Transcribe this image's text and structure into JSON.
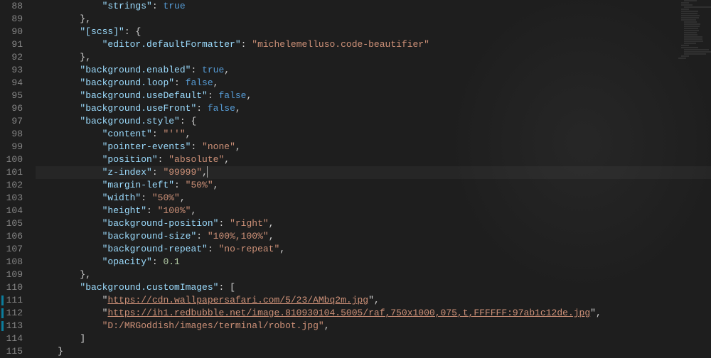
{
  "editor": {
    "startLine": 88,
    "highlightLine": 101,
    "modifiedLines": [
      111,
      112,
      113
    ],
    "lines": [
      {
        "n": 88,
        "indent": 3,
        "tokens": [
          {
            "t": "key",
            "v": "\"strings\""
          },
          {
            "t": "p",
            "v": ": "
          },
          {
            "t": "bool",
            "v": "true"
          }
        ]
      },
      {
        "n": 89,
        "indent": 2,
        "tokens": [
          {
            "t": "p",
            "v": "},"
          }
        ]
      },
      {
        "n": 90,
        "indent": 2,
        "tokens": [
          {
            "t": "key",
            "v": "\"[scss]\""
          },
          {
            "t": "p",
            "v": ": {"
          }
        ]
      },
      {
        "n": 91,
        "indent": 3,
        "tokens": [
          {
            "t": "key",
            "v": "\"editor.defaultFormatter\""
          },
          {
            "t": "p",
            "v": ": "
          },
          {
            "t": "str",
            "v": "\"michelemelluso.code-beautifier\""
          }
        ]
      },
      {
        "n": 92,
        "indent": 2,
        "tokens": [
          {
            "t": "p",
            "v": "},"
          }
        ]
      },
      {
        "n": 93,
        "indent": 2,
        "tokens": [
          {
            "t": "key",
            "v": "\"background.enabled\""
          },
          {
            "t": "p",
            "v": ": "
          },
          {
            "t": "bool",
            "v": "true"
          },
          {
            "t": "p",
            "v": ","
          }
        ]
      },
      {
        "n": 94,
        "indent": 2,
        "tokens": [
          {
            "t": "key",
            "v": "\"background.loop\""
          },
          {
            "t": "p",
            "v": ": "
          },
          {
            "t": "bool",
            "v": "false"
          },
          {
            "t": "p",
            "v": ","
          }
        ]
      },
      {
        "n": 95,
        "indent": 2,
        "tokens": [
          {
            "t": "key",
            "v": "\"background.useDefault\""
          },
          {
            "t": "p",
            "v": ": "
          },
          {
            "t": "bool",
            "v": "false"
          },
          {
            "t": "p",
            "v": ","
          }
        ]
      },
      {
        "n": 96,
        "indent": 2,
        "tokens": [
          {
            "t": "key",
            "v": "\"background.useFront\""
          },
          {
            "t": "p",
            "v": ": "
          },
          {
            "t": "bool",
            "v": "false"
          },
          {
            "t": "p",
            "v": ","
          }
        ]
      },
      {
        "n": 97,
        "indent": 2,
        "tokens": [
          {
            "t": "key",
            "v": "\"background.style\""
          },
          {
            "t": "p",
            "v": ": {"
          }
        ]
      },
      {
        "n": 98,
        "indent": 3,
        "tokens": [
          {
            "t": "key",
            "v": "\"content\""
          },
          {
            "t": "p",
            "v": ": "
          },
          {
            "t": "str",
            "v": "\"''\""
          },
          {
            "t": "p",
            "v": ","
          }
        ]
      },
      {
        "n": 99,
        "indent": 3,
        "tokens": [
          {
            "t": "key",
            "v": "\"pointer-events\""
          },
          {
            "t": "p",
            "v": ": "
          },
          {
            "t": "str",
            "v": "\"none\""
          },
          {
            "t": "p",
            "v": ","
          }
        ]
      },
      {
        "n": 100,
        "indent": 3,
        "tokens": [
          {
            "t": "key",
            "v": "\"position\""
          },
          {
            "t": "p",
            "v": ": "
          },
          {
            "t": "str",
            "v": "\"absolute\""
          },
          {
            "t": "p",
            "v": ","
          }
        ]
      },
      {
        "n": 101,
        "indent": 3,
        "tokens": [
          {
            "t": "key",
            "v": "\"z-index\""
          },
          {
            "t": "p",
            "v": ": "
          },
          {
            "t": "str",
            "v": "\"99999\""
          },
          {
            "t": "p",
            "v": ","
          },
          {
            "t": "cursor",
            "v": ""
          }
        ]
      },
      {
        "n": 102,
        "indent": 3,
        "tokens": [
          {
            "t": "key",
            "v": "\"margin-left\""
          },
          {
            "t": "p",
            "v": ": "
          },
          {
            "t": "str",
            "v": "\"50%\""
          },
          {
            "t": "p",
            "v": ","
          }
        ]
      },
      {
        "n": 103,
        "indent": 3,
        "tokens": [
          {
            "t": "key",
            "v": "\"width\""
          },
          {
            "t": "p",
            "v": ": "
          },
          {
            "t": "str",
            "v": "\"50%\""
          },
          {
            "t": "p",
            "v": ","
          }
        ]
      },
      {
        "n": 104,
        "indent": 3,
        "tokens": [
          {
            "t": "key",
            "v": "\"height\""
          },
          {
            "t": "p",
            "v": ": "
          },
          {
            "t": "str",
            "v": "\"100%\""
          },
          {
            "t": "p",
            "v": ","
          }
        ]
      },
      {
        "n": 105,
        "indent": 3,
        "tokens": [
          {
            "t": "key",
            "v": "\"background-position\""
          },
          {
            "t": "p",
            "v": ": "
          },
          {
            "t": "str",
            "v": "\"right\""
          },
          {
            "t": "p",
            "v": ","
          }
        ]
      },
      {
        "n": 106,
        "indent": 3,
        "tokens": [
          {
            "t": "key",
            "v": "\"background-size\""
          },
          {
            "t": "p",
            "v": ": "
          },
          {
            "t": "str",
            "v": "\"100%,100%\""
          },
          {
            "t": "p",
            "v": ","
          }
        ]
      },
      {
        "n": 107,
        "indent": 3,
        "tokens": [
          {
            "t": "key",
            "v": "\"background-repeat\""
          },
          {
            "t": "p",
            "v": ": "
          },
          {
            "t": "str",
            "v": "\"no-repeat\""
          },
          {
            "t": "p",
            "v": ","
          }
        ]
      },
      {
        "n": 108,
        "indent": 3,
        "tokens": [
          {
            "t": "key",
            "v": "\"opacity\""
          },
          {
            "t": "p",
            "v": ": "
          },
          {
            "t": "num",
            "v": "0.1"
          }
        ]
      },
      {
        "n": 109,
        "indent": 2,
        "tokens": [
          {
            "t": "p",
            "v": "},"
          }
        ]
      },
      {
        "n": 110,
        "indent": 2,
        "tokens": [
          {
            "t": "key",
            "v": "\"background.customImages\""
          },
          {
            "t": "p",
            "v": ": ["
          }
        ]
      },
      {
        "n": 111,
        "indent": 3,
        "tokens": [
          {
            "t": "p",
            "v": "\""
          },
          {
            "t": "url",
            "v": "https://cdn.wallpapersafari.com/5/23/AMbq2m.jpg"
          },
          {
            "t": "p",
            "v": "\","
          }
        ]
      },
      {
        "n": 112,
        "indent": 3,
        "tokens": [
          {
            "t": "p",
            "v": "\""
          },
          {
            "t": "url",
            "v": "https://ih1.redbubble.net/image.810930104.5005/raf,750x1000,075,t,FFFFFF:97ab1c12de.jpg"
          },
          {
            "t": "p",
            "v": "\","
          }
        ]
      },
      {
        "n": 113,
        "indent": 3,
        "tokens": [
          {
            "t": "str",
            "v": "\"D:/MRGoddish/images/terminal/robot.jpg\""
          },
          {
            "t": "p",
            "v": ","
          }
        ]
      },
      {
        "n": 114,
        "indent": 2,
        "tokens": [
          {
            "t": "p",
            "v": "]"
          }
        ]
      },
      {
        "n": 115,
        "indent": 1,
        "tokens": [
          {
            "t": "p",
            "v": "}"
          }
        ]
      }
    ]
  }
}
